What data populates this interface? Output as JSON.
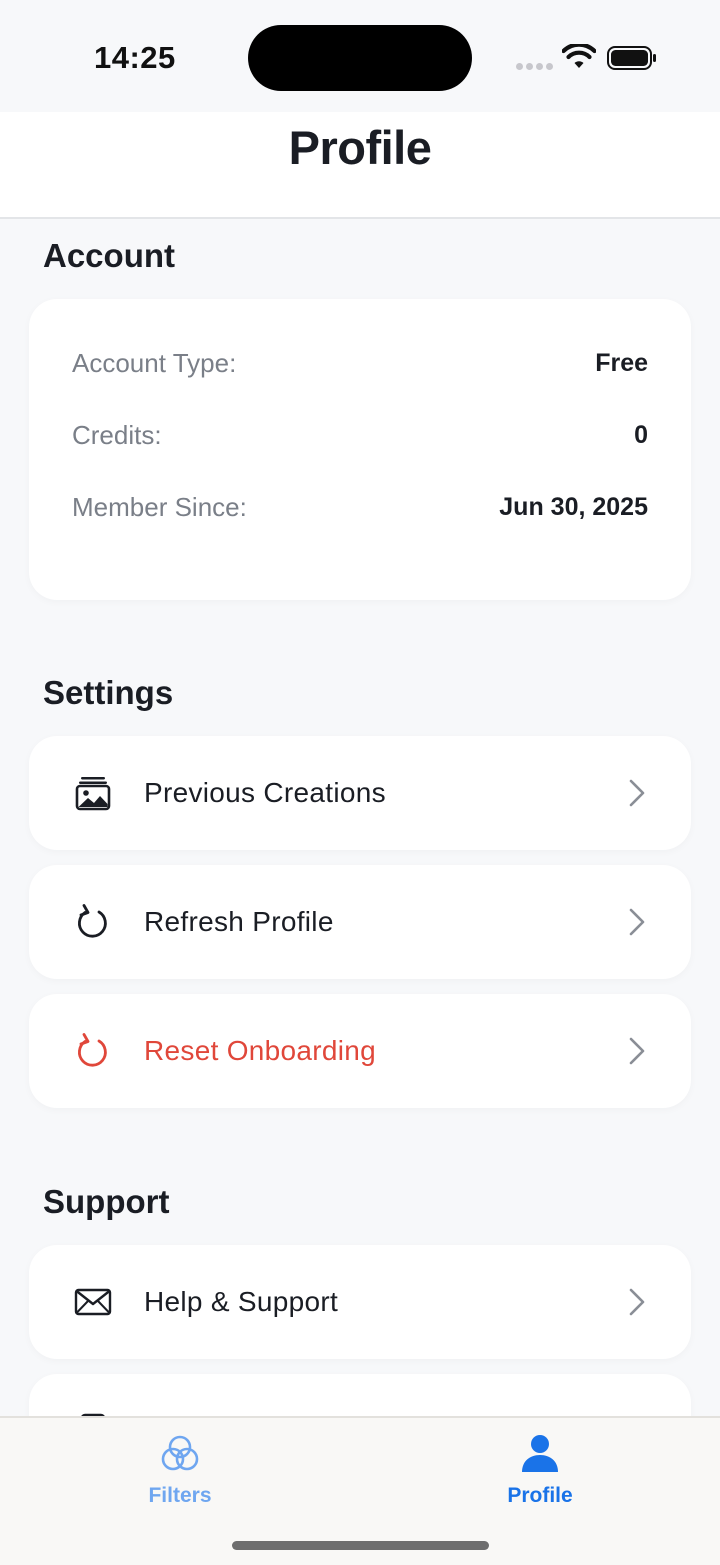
{
  "status_bar": {
    "time": "14:25"
  },
  "header": {
    "title": "Profile"
  },
  "account": {
    "section_title": "Account",
    "rows": [
      {
        "label": "Account Type:",
        "value": "Free"
      },
      {
        "label": "Credits:",
        "value": "0"
      },
      {
        "label": "Member Since:",
        "value": "Jun 30, 2025"
      }
    ]
  },
  "settings": {
    "section_title": "Settings",
    "items": [
      {
        "label": "Previous Creations",
        "icon": "photo-stack-icon"
      },
      {
        "label": "Refresh Profile",
        "icon": "refresh-icon"
      },
      {
        "label": "Reset Onboarding",
        "icon": "refresh-icon",
        "color": "#e0473a"
      }
    ]
  },
  "support": {
    "section_title": "Support",
    "items": [
      {
        "label": "Help & Support",
        "icon": "envelope-icon"
      },
      {
        "label": "",
        "icon": "document-icon"
      }
    ]
  },
  "tab_bar": {
    "tabs": [
      {
        "label": "Filters",
        "icon": "filters-icon",
        "active": false,
        "color": "#6fa6f0"
      },
      {
        "label": "Profile",
        "icon": "person-icon",
        "active": true,
        "color": "#1a73e8"
      }
    ]
  },
  "colors": {
    "accent": "#1a73e8",
    "danger": "#e0473a",
    "background": "#f7f8fa"
  }
}
